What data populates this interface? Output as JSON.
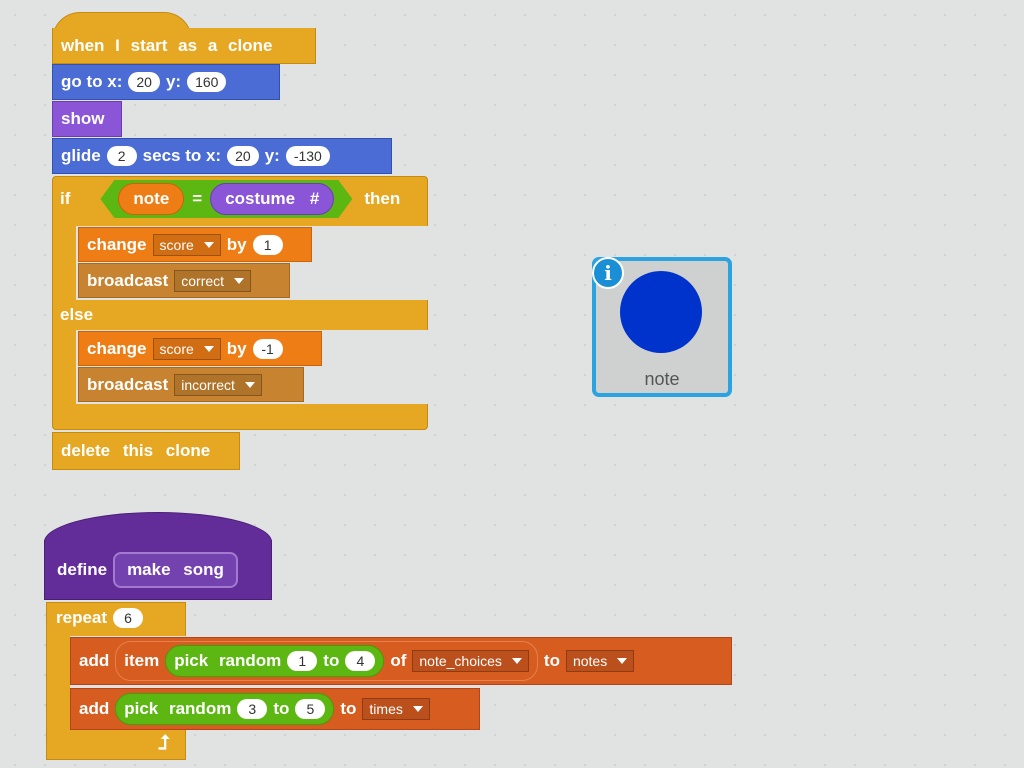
{
  "script1": {
    "hat": "when I start as a clone",
    "goto": {
      "label1": "go to x:",
      "x": "20",
      "label2": "y:",
      "y": "160"
    },
    "show": "show",
    "glide": {
      "l1": "glide",
      "secs": "2",
      "l2": "secs to x:",
      "x": "20",
      "l3": "y:",
      "y": "-130"
    },
    "if": {
      "if_label": "if",
      "left": "note",
      "op": "=",
      "right": "costume #",
      "then_label": "then"
    },
    "change1": {
      "label": "change",
      "var": "score",
      "by": "by",
      "val": "1"
    },
    "broadcast1": {
      "label": "broadcast",
      "msg": "correct"
    },
    "else_label": "else",
    "change2": {
      "label": "change",
      "var": "score",
      "by": "by",
      "val": "-1"
    },
    "broadcast2": {
      "label": "broadcast",
      "msg": "incorrect"
    },
    "delete": "delete this clone"
  },
  "sprite": {
    "name": "note",
    "color": "#0033cc",
    "info_icon": "i"
  },
  "script2": {
    "define": "define",
    "proc": "make song",
    "repeat": {
      "label": "repeat",
      "count": "6"
    },
    "add1": {
      "add": "add",
      "item": "item",
      "pick": "pick random",
      "from": "1",
      "to": "to",
      "upto": "4",
      "of": "of",
      "list_src": "note_choices",
      "to2": "to",
      "list_dst": "notes"
    },
    "add2": {
      "add": "add",
      "pick": "pick random",
      "from": "3",
      "to": "to",
      "upto": "5",
      "to2": "to",
      "list_dst": "times"
    }
  }
}
